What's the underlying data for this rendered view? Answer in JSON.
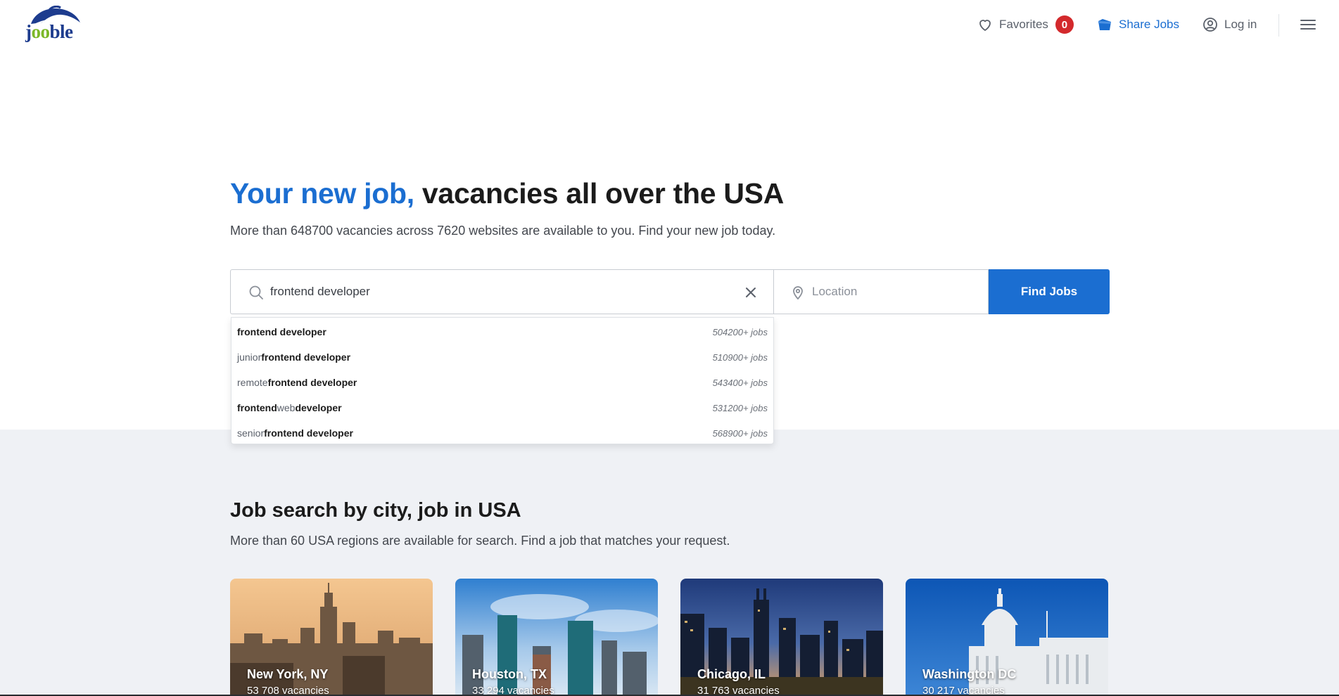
{
  "header": {
    "logo_text_a": "j",
    "logo_text_b": "oo",
    "logo_text_c": "ble",
    "favorites_label": "Favorites",
    "favorites_count": "0",
    "share_label": "Share Jobs",
    "login_label": "Log in"
  },
  "hero": {
    "title_accent": "Your new job,",
    "title_rest": " vacancies all over the USA",
    "subtitle": "More than 648700 vacancies across 7620 websites are available to you. Find your new job today."
  },
  "search": {
    "query_value": "frontend developer",
    "location_placeholder": "Location",
    "find_label": "Find Jobs"
  },
  "suggestions": [
    {
      "pre": "",
      "b1": "frontend developer",
      "mid": "",
      "b2": "",
      "count": "504200+ jobs"
    },
    {
      "pre": "junior ",
      "b1": "frontend developer",
      "mid": "",
      "b2": "",
      "count": "510900+ jobs"
    },
    {
      "pre": "remote ",
      "b1": "frontend developer",
      "mid": "",
      "b2": "",
      "count": "543400+ jobs"
    },
    {
      "pre": "",
      "b1": "frontend",
      "mid": " web ",
      "b2": "developer",
      "count": "531200+ jobs"
    },
    {
      "pre": "senior ",
      "b1": "frontend developer",
      "mid": "",
      "b2": "",
      "count": "568900+ jobs"
    }
  ],
  "cities": {
    "title": "Job search by city, job in USA",
    "subtitle": "More than 60 USA regions are available for search. Find a job that matches your request.",
    "cards": [
      {
        "name": "New York, NY",
        "count": "53 708 vacancies"
      },
      {
        "name": "Houston, TX",
        "count": "33 294 vacancies"
      },
      {
        "name": "Chicago, IL",
        "count": "31 763 vacancies"
      },
      {
        "name": "Washington DC",
        "count": "30 217 vacancies"
      }
    ]
  },
  "colors": {
    "accent": "#1b6ed1",
    "badge": "#d3292c",
    "logo_blue": "#1d3c8e",
    "logo_green": "#7cb829",
    "section_bg": "#eff1f5"
  },
  "icons": [
    "jooble-logo",
    "heart-icon",
    "share-folder-icon",
    "user-circle-icon",
    "menu-icon",
    "search-icon",
    "close-icon",
    "location-pin-icon"
  ]
}
